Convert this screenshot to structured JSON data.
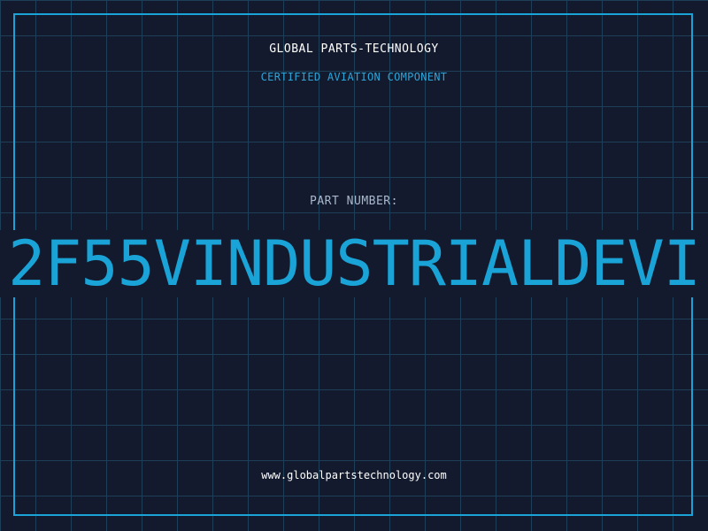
{
  "header": {
    "company": "GLOBAL PARTS-TECHNOLOGY",
    "subtitle": "CERTIFIED AVIATION COMPONENT"
  },
  "part": {
    "label": "PART NUMBER:",
    "number": "2F55VINDUSTRIALDEVI"
  },
  "footer": {
    "url": "www.globalpartstechnology.com"
  },
  "colors": {
    "background": "#131a2e",
    "grid": "#1d3f57",
    "accent": "#1aa3d6",
    "text": "#ffffff"
  }
}
